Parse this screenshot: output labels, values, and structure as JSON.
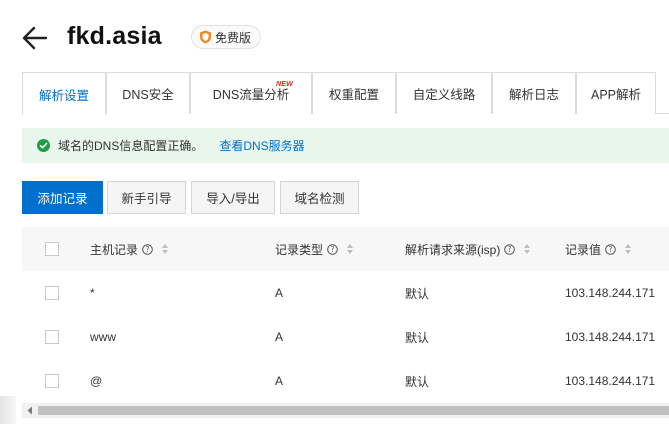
{
  "header": {
    "domain": "fkd.asia",
    "badge": "免费版"
  },
  "tabs": [
    {
      "label": "解析设置",
      "active": true
    },
    {
      "label": "DNS安全",
      "dot": true
    },
    {
      "label": "DNS流量分析",
      "tag": "NEW"
    },
    {
      "label": "权重配置"
    },
    {
      "label": "自定义线路"
    },
    {
      "label": "解析日志"
    },
    {
      "label": "APP解析"
    }
  ],
  "alert": {
    "message": "域名的DNS信息配置正确。",
    "link": "查看DNS服务器"
  },
  "toolbar": {
    "add_record": "添加记录",
    "guide": "新手引导",
    "import_export": "导入/导出",
    "domain_check": "域名检测"
  },
  "table": {
    "columns": {
      "host": "主机记录",
      "type": "记录类型",
      "isp": "解析请求来源(isp)",
      "value": "记录值"
    },
    "rows": [
      {
        "host": "*",
        "type": "A",
        "isp": "默认",
        "value": "103.148.244.171"
      },
      {
        "host": "www",
        "type": "A",
        "isp": "默认",
        "value": "103.148.244.171"
      },
      {
        "host": "@",
        "type": "A",
        "isp": "默认",
        "value": "103.148.244.171"
      }
    ]
  },
  "colors": {
    "accent": "#0070cc",
    "success": "#1e9e47",
    "alert_bg": "#e9f6ec",
    "badge_orange": "#f08a24",
    "dot_red": "#d9001b"
  },
  "icons": {
    "back": "arrow-left-icon",
    "badge": "shield-icon",
    "alert": "check-circle-icon",
    "help": "question-circle-icon",
    "sort": "sort-icon"
  }
}
